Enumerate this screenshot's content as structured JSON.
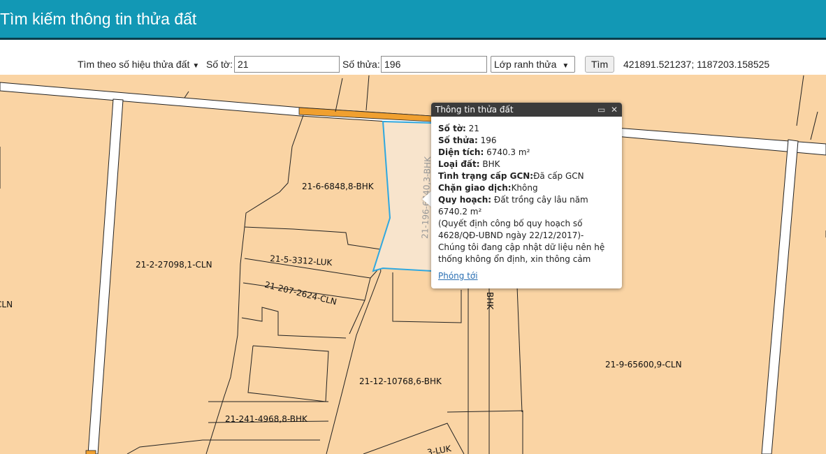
{
  "header": {
    "title": "Tìm kiếm thông tin thửa đất"
  },
  "toolbar": {
    "search_mode": "Tìm theo số hiệu thửa đất",
    "sheet_label": "Số tờ:",
    "sheet_value": "21",
    "parcel_label": "Số thửa:",
    "parcel_value": "196",
    "layer_select": "Lớp ranh thửa",
    "search_button": "Tìm",
    "coordinates": "421891.521237; 1187203.158525"
  },
  "map": {
    "colors": {
      "parcel_fill": "#fad4a4",
      "boundary": "#222222",
      "road": "#ffffff",
      "highlight_fill": "#f8e4cc",
      "highlight_border": "#2fa8e0",
      "road_segment": "#f0a030"
    },
    "parcel_labels": [
      "21-6-6848,8-BHK",
      "21-5-3312-LUK",
      "21-207-2624-CLN",
      "21-2-27098,1-CLN",
      "21-12-10768,6-BHK",
      "21-241-4968,8-BHK",
      "21-9-65600,9-CLN",
      "21-196-6740,3-BHK",
      "BHK",
      "CLN",
      "3-LUK"
    ]
  },
  "popup": {
    "title": "Thông tin thửa đất",
    "so_to_label": "Số tờ:",
    "so_to_value": "21",
    "so_thua_label": "Số thửa:",
    "so_thua_value": "196",
    "dien_tich_label": "Diện tích:",
    "dien_tich_value": "6740.3 m²",
    "loai_dat_label": "Loại đất:",
    "loai_dat_value": "BHK",
    "gcn_label": "Tình trạng cấp GCN:",
    "gcn_value": "Đã cấp GCN",
    "chan_label": "Chặn giao dịch:",
    "chan_value": "Không",
    "quy_hoach_label": "Quy hoạch:",
    "quy_hoach_line1": "Đất trồng cây lâu năm",
    "quy_hoach_line2": "6740.2 m²",
    "note_line1": "(Quyết định công bố quy hoạch số",
    "note_line2": "4628/QĐ-UBND ngày 22/12/2017)-",
    "note_line3": "Chúng tôi đang cập nhật dữ liệu nên hệ",
    "note_line4": "thống không ổn định, xin thông cảm",
    "zoom_link": "Phóng tới"
  }
}
